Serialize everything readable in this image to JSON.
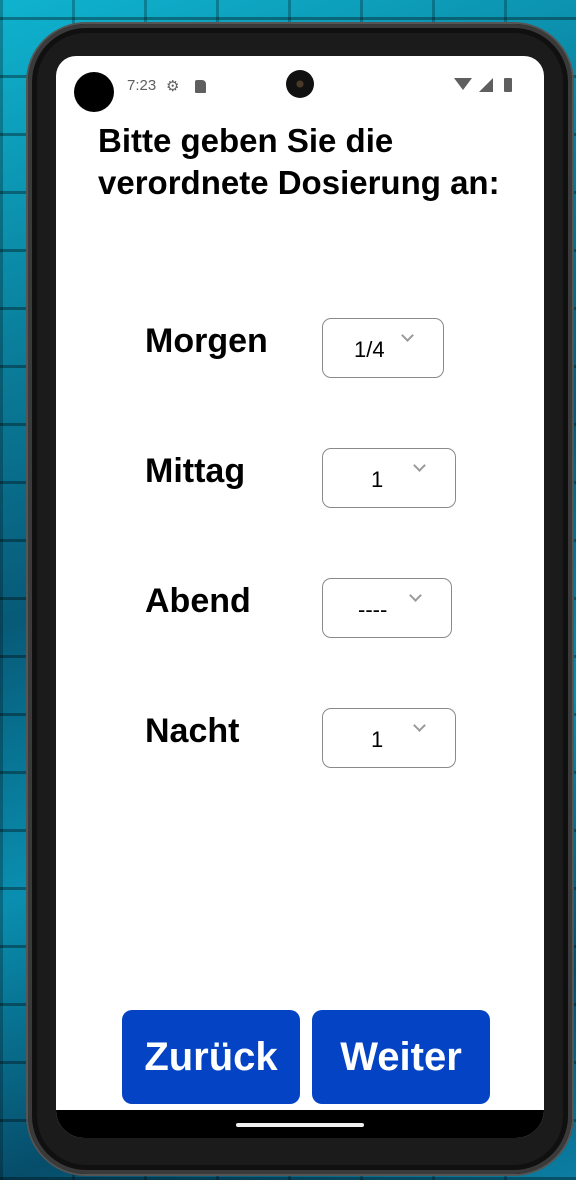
{
  "status_bar": {
    "time": "7:23",
    "icons": [
      "settings-icon",
      "sd-card-icon",
      "wifi-icon",
      "signal-icon",
      "battery-icon"
    ]
  },
  "screen": {
    "title": "Bitte geben Sie die verordnete Dosierung an:"
  },
  "dosage": [
    {
      "label": "Morgen",
      "value": "1/4"
    },
    {
      "label": "Mittag",
      "value": "1"
    },
    {
      "label": "Abend",
      "value": "----"
    },
    {
      "label": "Nacht",
      "value": "1"
    }
  ],
  "buttons": {
    "back_label": "Zurück",
    "next_label": "Weiter"
  },
  "colors": {
    "button_primary": "#0444c4",
    "text": "#000000",
    "background": "#ffffff"
  }
}
